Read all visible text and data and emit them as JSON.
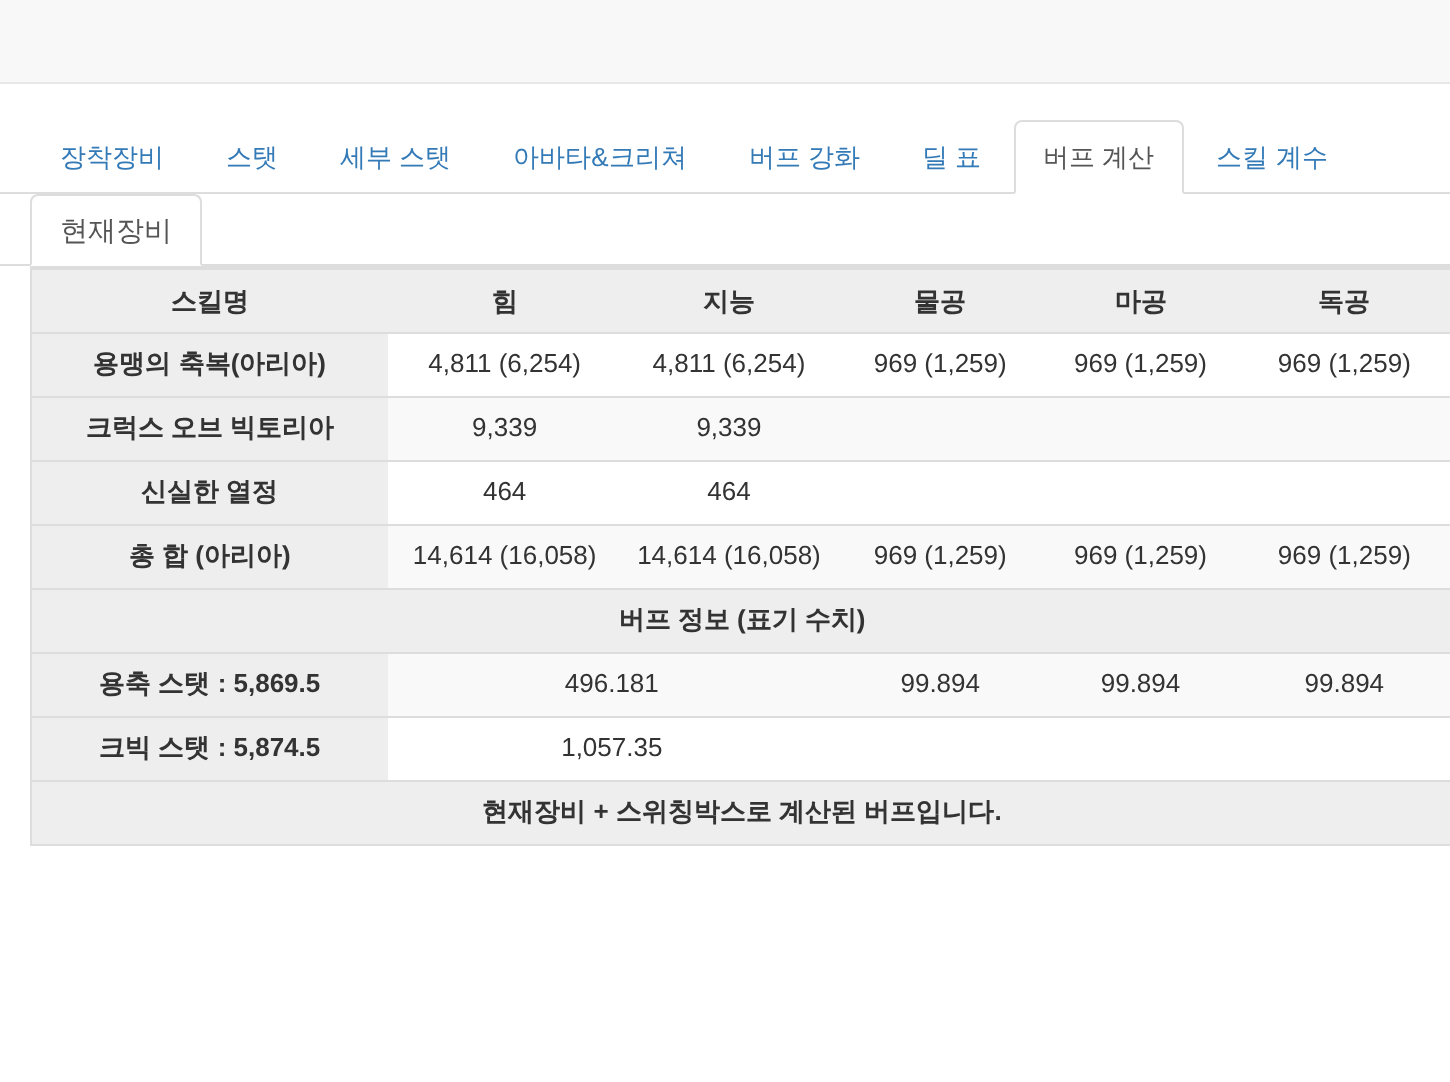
{
  "tabs": [
    {
      "label": "장착장비",
      "selected": false
    },
    {
      "label": "스탯",
      "selected": false
    },
    {
      "label": "세부 스탯",
      "selected": false
    },
    {
      "label": "아바타&크리쳐",
      "selected": false
    },
    {
      "label": "버프 강화",
      "selected": false
    },
    {
      "label": "딜 표",
      "selected": false
    },
    {
      "label": "버프 계산",
      "selected": true
    },
    {
      "label": "스킬 계수",
      "selected": false
    }
  ],
  "subtabs": [
    {
      "label": "현재장비",
      "selected": true
    }
  ],
  "table": {
    "columns": [
      "스킬명",
      "힘",
      "지능",
      "물공",
      "마공",
      "독공"
    ],
    "rows": [
      {
        "kind": "data",
        "label": "용맹의 축복(아리아)",
        "values": [
          "4,811 (6,254)",
          "4,811 (6,254)",
          "969 (1,259)",
          "969 (1,259)",
          "969 (1,259)"
        ]
      },
      {
        "kind": "data",
        "label": "크럭스 오브 빅토리아",
        "values": [
          "9,339",
          "9,339"
        ]
      },
      {
        "kind": "data",
        "label": "신실한 열정",
        "values": [
          "464",
          "464"
        ]
      },
      {
        "kind": "data",
        "label": "총 합 (아리아)",
        "values": [
          "14,614 (16,058)",
          "14,614 (16,058)",
          "969 (1,259)",
          "969 (1,259)",
          "969 (1,259)"
        ]
      },
      {
        "kind": "section",
        "label": "버프 정보 (표기 수치)"
      },
      {
        "kind": "buff",
        "label": "용축 스탯 : 5,869.5",
        "combined": "496.181",
        "values": [
          "99.894",
          "99.894",
          "99.894"
        ]
      },
      {
        "kind": "buff",
        "label": "크빅 스탯 : 5,874.5",
        "combined": "1,057.35",
        "values": []
      },
      {
        "kind": "section",
        "label": "현재장비 + 스위칭박스로 계산된 버프입니다."
      }
    ]
  }
}
